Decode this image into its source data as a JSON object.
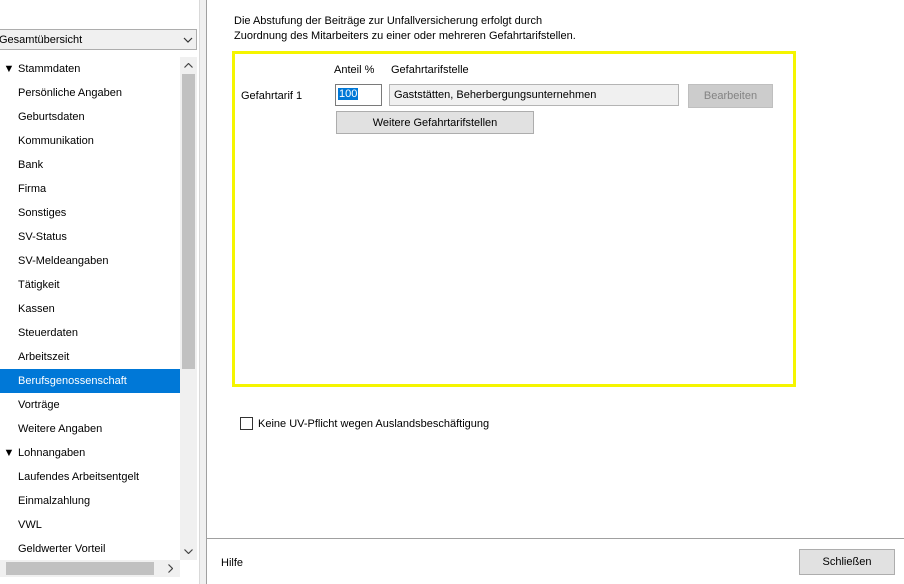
{
  "sidebar": {
    "view_select": "Gesamtübersicht",
    "tree": [
      {
        "type": "group",
        "label": "Stammdaten"
      },
      {
        "type": "item",
        "label": "Persönliche Angaben"
      },
      {
        "type": "item",
        "label": "Geburtsdaten"
      },
      {
        "type": "item",
        "label": "Kommunikation"
      },
      {
        "type": "item",
        "label": "Bank"
      },
      {
        "type": "item",
        "label": "Firma"
      },
      {
        "type": "item",
        "label": "Sonstiges"
      },
      {
        "type": "item",
        "label": "SV-Status"
      },
      {
        "type": "item",
        "label": "SV-Meldeangaben"
      },
      {
        "type": "item",
        "label": "Tätigkeit"
      },
      {
        "type": "item",
        "label": "Kassen"
      },
      {
        "type": "item",
        "label": "Steuerdaten"
      },
      {
        "type": "item",
        "label": "Arbeitszeit"
      },
      {
        "type": "item",
        "label": "Berufsgenossenschaft",
        "selected": true
      },
      {
        "type": "item",
        "label": "Vorträge"
      },
      {
        "type": "item",
        "label": "Weitere Angaben"
      },
      {
        "type": "group",
        "label": "Lohnangaben"
      },
      {
        "type": "item",
        "label": "Laufendes Arbeitsentgelt"
      },
      {
        "type": "item",
        "label": "Einmalzahlung"
      },
      {
        "type": "item",
        "label": "VWL"
      },
      {
        "type": "item",
        "label": "Geldwerter Vorteil"
      }
    ]
  },
  "main": {
    "intro_line1": "Die Abstufung der Beiträge zur Unfallversicherung erfolgt durch",
    "intro_line2": "Zuordnung des Mitarbeiters zu einer oder mehreren Gefahrtarifstellen.",
    "col_anteil": "Anteil %",
    "col_stelle": "Gefahrtarifstelle",
    "row_label": "Gefahrtarif 1",
    "share_value": "100",
    "tarif_value": "Gaststätten, Beherbergungsunternehmen",
    "edit_label": "Bearbeiten",
    "more_label": "Weitere Gefahrtarifstellen",
    "checkbox_label": "Keine UV-Pflicht wegen Auslandsbeschäftigung",
    "checkbox_checked": false,
    "highlight_color": "#f5f500"
  },
  "footer": {
    "help": "Hilfe",
    "close": "Schließen"
  }
}
